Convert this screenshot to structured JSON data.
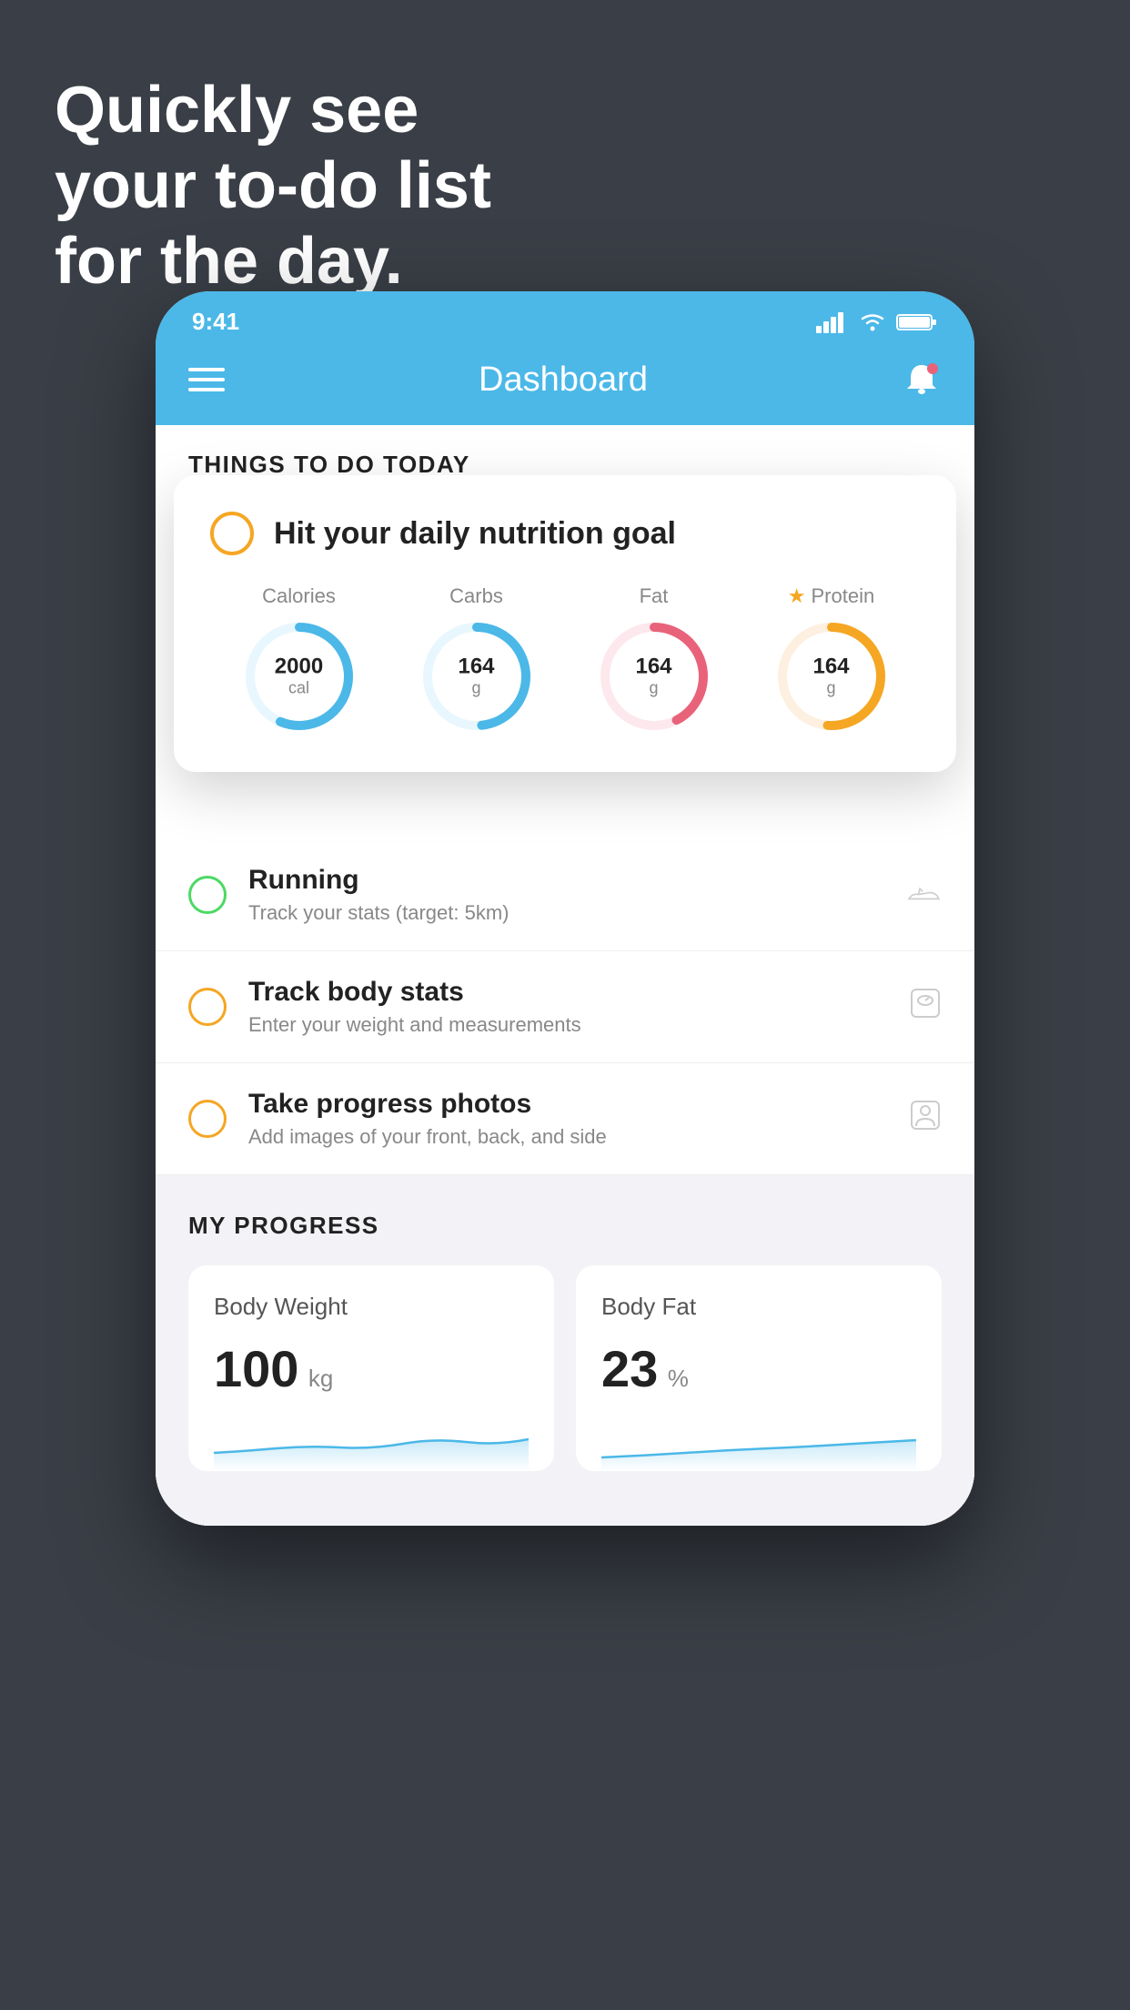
{
  "hero": {
    "line1": "Quickly see",
    "line2": "your to-do list",
    "line3": "for the day."
  },
  "statusBar": {
    "time": "9:41"
  },
  "nav": {
    "title": "Dashboard"
  },
  "thingsToday": {
    "sectionLabel": "THINGS TO DO TODAY"
  },
  "floatingCard": {
    "title": "Hit your daily nutrition goal",
    "nutrition": {
      "calories": {
        "label": "Calories",
        "value": "2000",
        "unit": "cal",
        "color": "#4bb8e8",
        "track": 75
      },
      "carbs": {
        "label": "Carbs",
        "value": "164",
        "unit": "g",
        "color": "#4bb8e8",
        "track": 60
      },
      "fat": {
        "label": "Fat",
        "value": "164",
        "unit": "g",
        "color": "#e8637a",
        "track": 50
      },
      "protein": {
        "label": "Protein",
        "value": "164",
        "unit": "g",
        "color": "#f5a623",
        "track": 65,
        "starred": true
      }
    }
  },
  "todoItems": [
    {
      "id": "running",
      "title": "Running",
      "subtitle": "Track your stats (target: 5km)",
      "circleColor": "green",
      "icon": "shoe"
    },
    {
      "id": "body-stats",
      "title": "Track body stats",
      "subtitle": "Enter your weight and measurements",
      "circleColor": "yellow",
      "icon": "scale"
    },
    {
      "id": "photos",
      "title": "Take progress photos",
      "subtitle": "Add images of your front, back, and side",
      "circleColor": "yellow",
      "icon": "person"
    }
  ],
  "progress": {
    "sectionLabel": "MY PROGRESS",
    "cards": [
      {
        "title": "Body Weight",
        "value": "100",
        "unit": "kg"
      },
      {
        "title": "Body Fat",
        "value": "23",
        "unit": "%"
      }
    ]
  },
  "colors": {
    "headerBg": "#4bb8e8",
    "bgDark": "#3a3f47",
    "white": "#ffffff",
    "caloriesRing": "#4bb8e8",
    "carbsRing": "#4bb8e8",
    "fatRing": "#e8637a",
    "proteinRing": "#f5a623"
  }
}
